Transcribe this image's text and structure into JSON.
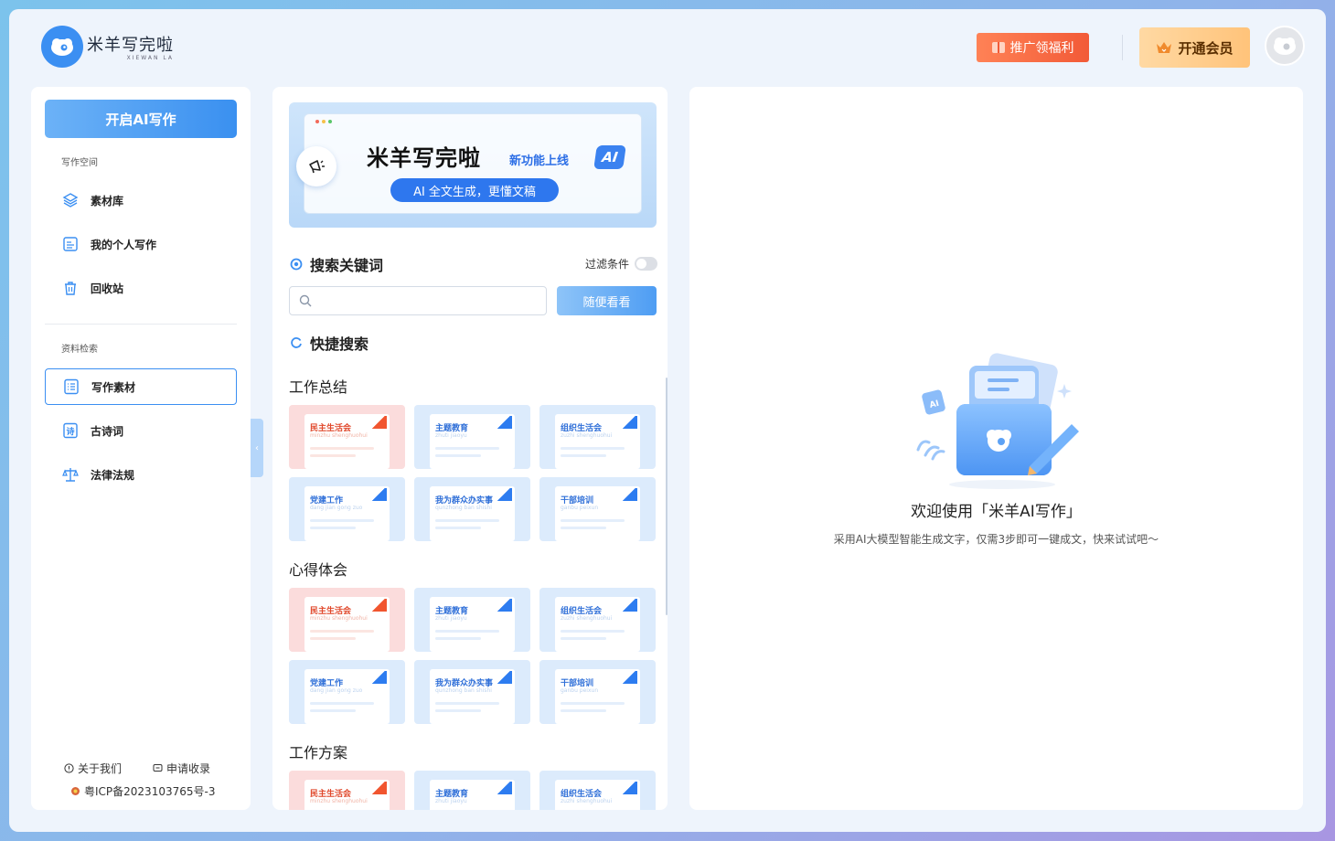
{
  "header": {
    "logo_title": "米羊写完啦",
    "logo_sub": "XIEWAN LA",
    "promo_label": "推广领福利",
    "vip_label": "开通会员"
  },
  "sidebar": {
    "start_label": "开启AI写作",
    "section_workspace": "写作空间",
    "section_research": "资料检索",
    "items": [
      {
        "label": "素材库",
        "icon": "layers-icon"
      },
      {
        "label": "我的个人写作",
        "icon": "document-icon"
      },
      {
        "label": "回收站",
        "icon": "trash-icon"
      },
      {
        "label": "写作素材",
        "icon": "list-icon",
        "active": true
      },
      {
        "label": "古诗词",
        "icon": "poem-icon"
      },
      {
        "label": "法律法规",
        "icon": "scale-icon"
      }
    ],
    "footer": {
      "about_label": "关于我们",
      "apply_label": "申请收录",
      "icp": "粤ICP备2023103765号-3"
    }
  },
  "banner": {
    "title": "米羊写完啦",
    "new_feature": "新功能上线",
    "ai_badge": "AI",
    "pill": "AI 全文生成，更懂文稿"
  },
  "search": {
    "section_title": "搜索关键词",
    "filter_label": "过滤条件",
    "placeholder": "",
    "random_label": "随便看看"
  },
  "quick": {
    "section_title": "快捷搜索",
    "categories": [
      {
        "title": "工作总结",
        "cards": [
          {
            "title": "民主生活会",
            "pinyin": "minzhu shenghuohui",
            "color": "red"
          },
          {
            "title": "主题教育",
            "pinyin": "zhuti jiaoyu",
            "color": "blue"
          },
          {
            "title": "组织生活会",
            "pinyin": "zuzhi shenghuohui",
            "color": "blue"
          },
          {
            "title": "党建工作",
            "pinyin": "dang jian gong zuo",
            "color": "blue"
          },
          {
            "title": "我为群众办实事",
            "pinyin": "qunzhong ban shishi",
            "color": "blue"
          },
          {
            "title": "干部培训",
            "pinyin": "ganbu peixun",
            "color": "blue"
          }
        ]
      },
      {
        "title": "心得体会",
        "cards": [
          {
            "title": "民主生活会",
            "pinyin": "minzhu shenghuohui",
            "color": "red"
          },
          {
            "title": "主题教育",
            "pinyin": "zhuti jiaoyu",
            "color": "blue"
          },
          {
            "title": "组织生活会",
            "pinyin": "zuzhi shenghuohui",
            "color": "blue"
          },
          {
            "title": "党建工作",
            "pinyin": "dang jian gong zuo",
            "color": "blue"
          },
          {
            "title": "我为群众办实事",
            "pinyin": "qunzhong ban shishi",
            "color": "blue"
          },
          {
            "title": "干部培训",
            "pinyin": "ganbu peixun",
            "color": "blue"
          }
        ]
      },
      {
        "title": "工作方案",
        "cards": [
          {
            "title": "民主生活会",
            "pinyin": "minzhu shenghuohui",
            "color": "red"
          },
          {
            "title": "主题教育",
            "pinyin": "zhuti jiaoyu",
            "color": "blue"
          },
          {
            "title": "组织生活会",
            "pinyin": "zuzhi shenghuohui",
            "color": "blue"
          }
        ]
      }
    ]
  },
  "welcome": {
    "title": "欢迎使用「米羊AI写作」",
    "subtitle": "采用AI大模型智能生成文字，仅需3步即可一键成文，快来试试吧～"
  },
  "colors": {
    "brand_blue": "#3b8ff2",
    "promo_red": "#f25a37",
    "vip_gold": "#ffc37a"
  }
}
